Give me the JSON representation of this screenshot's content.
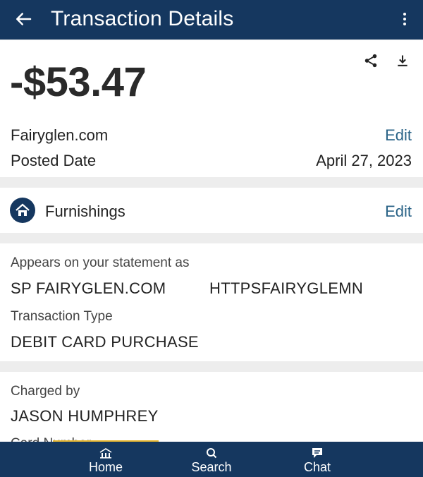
{
  "header": {
    "title": "Transaction Details",
    "back_icon": "arrow-left-icon",
    "menu_icon": "more-vertical-icon"
  },
  "summary": {
    "amount": "-$53.47",
    "merchant": "Fairyglen.com",
    "merchant_edit": "Edit",
    "posted_label": "Posted Date",
    "posted_value": "April 27, 2023",
    "share_icon": "share-icon",
    "download_icon": "download-icon"
  },
  "category": {
    "label": "Furnishings",
    "edit": "Edit",
    "icon": "home-furnishings-icon"
  },
  "statement": {
    "label": "Appears on your statement as",
    "value_left": "SP FAIRYGLEN.COM",
    "value_right": "HTTPSFAIRYGLEMN",
    "type_label": "Transaction Type",
    "type_value": "DEBIT CARD PURCHASE"
  },
  "charged": {
    "label": "Charged by",
    "value": "JASON HUMPHREY",
    "next_label_partial": "Card Number"
  },
  "bottom_nav": {
    "items": [
      {
        "label": "Home",
        "icon": "bank-home-icon"
      },
      {
        "label": "Search",
        "icon": "search-icon"
      },
      {
        "label": "Chat",
        "icon": "chat-icon"
      }
    ]
  },
  "colors": {
    "header": "#15375f",
    "link": "#2a6387",
    "accent_bar": "#e8b730"
  }
}
